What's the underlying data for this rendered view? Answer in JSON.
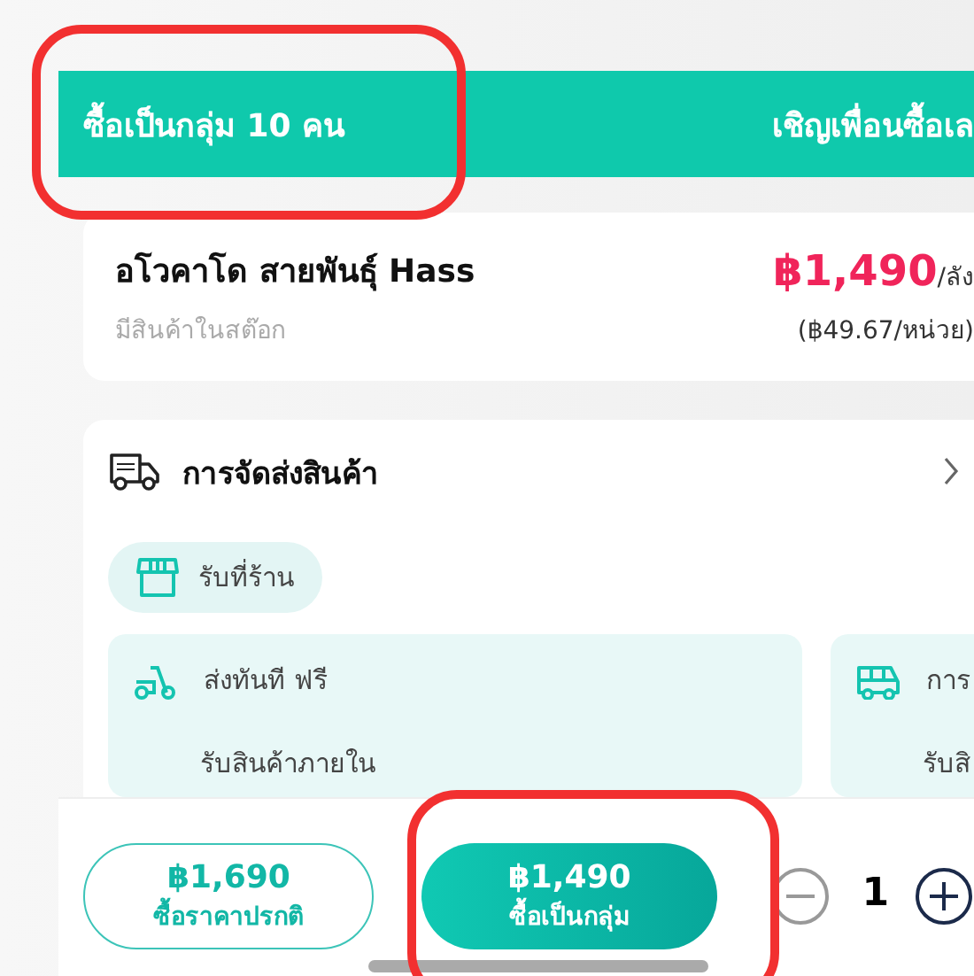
{
  "banner": {
    "title": "ซื้อเป็นกลุ่ม 10 คน",
    "action": "เชิญเพื่อนซื้อเล"
  },
  "product": {
    "name": "อโวคาโด สายพันธุ์ Hass",
    "stock": "มีสินค้าในสต๊อก",
    "price": "฿1,490",
    "unit": "/ลัง",
    "unit_price": "(฿49.67/หน่วย)"
  },
  "delivery": {
    "title": "การจัดส่งสินค้า",
    "pickup": "รับที่ร้าน",
    "options": [
      {
        "kind": "scooter",
        "name": "ส่งทันที ฟรี",
        "note": "รับสินค้าภายใน"
      },
      {
        "kind": "van",
        "name": "การ",
        "note": "รับสิ"
      }
    ]
  },
  "footer": {
    "buttons": [
      {
        "kind": "outline",
        "price": "฿1,690",
        "label": "ซื้อราคาปรกติ"
      },
      {
        "kind": "filled",
        "price": "฿1,490",
        "label": "ซื้อเป็นกลุ่ม"
      }
    ],
    "quantity": "1"
  }
}
